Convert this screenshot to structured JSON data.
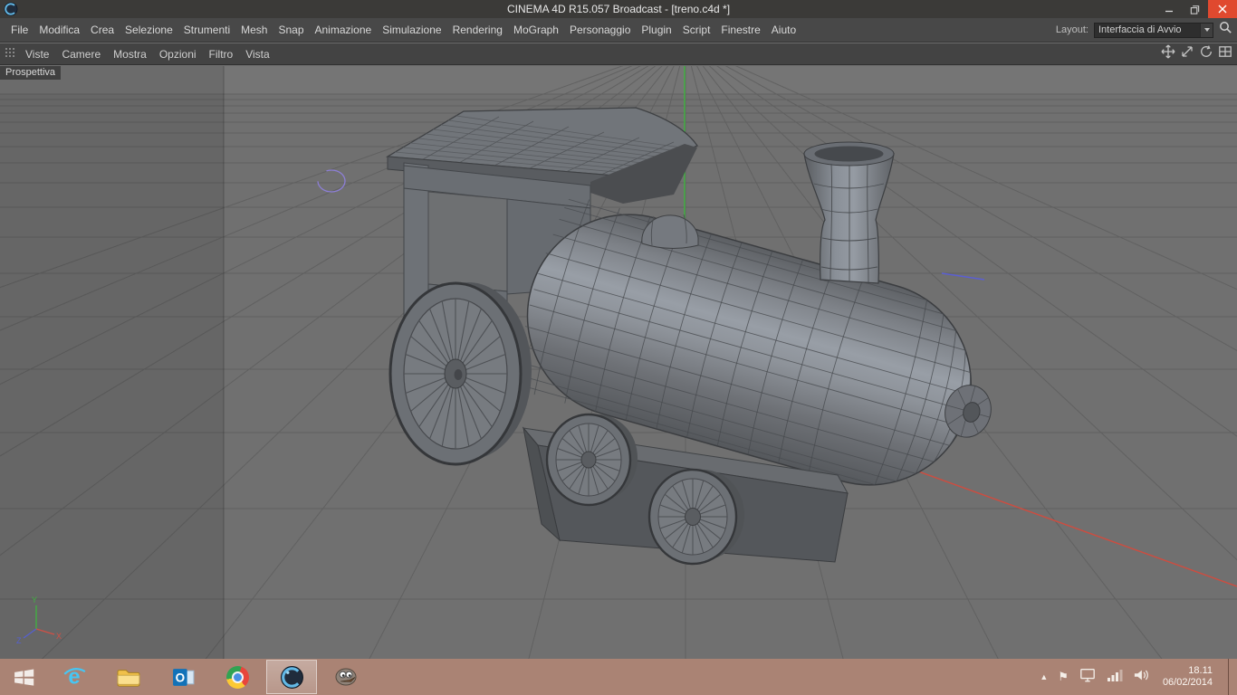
{
  "window": {
    "title": "CINEMA 4D R15.057 Broadcast - [treno.c4d *]"
  },
  "menubar": {
    "items": [
      "File",
      "Modifica",
      "Crea",
      "Selezione",
      "Strumenti",
      "Mesh",
      "Snap",
      "Animazione",
      "Simulazione",
      "Rendering",
      "MoGraph",
      "Personaggio",
      "Plugin",
      "Script",
      "Finestre",
      "Aiuto"
    ],
    "layout_label": "Layout:",
    "layout_value": "Interfaccia di Avvio"
  },
  "viewport_toolbar": {
    "items": [
      "Viste",
      "Camere",
      "Mostra",
      "Opzioni",
      "Filtro",
      "Vista"
    ]
  },
  "viewport": {
    "view_label": "Prospettiva",
    "axis_labels": {
      "x": "X",
      "y": "Y",
      "z": "Z"
    }
  },
  "taskbar": {
    "app_icons": [
      "start",
      "internet-explorer",
      "file-explorer",
      "outlook",
      "chrome",
      "cinema-4d",
      "gimp"
    ],
    "active_app": "cinema-4d",
    "ie_glyph": "e",
    "outlook_glyph": "O",
    "tray": {
      "hidden_icons_glyph": "▲",
      "flag_glyph": "⚑",
      "time": "18.11",
      "date": "06/02/2014"
    }
  },
  "colors": {
    "axis_x": "#cf4c3f",
    "axis_y": "#3fb53f",
    "axis_z": "#5b5fd2",
    "close_button": "#e0492f",
    "taskbar": "#aa8374",
    "viewport_bg": "#6f6f6f",
    "titlebar": "#3b3a38"
  }
}
